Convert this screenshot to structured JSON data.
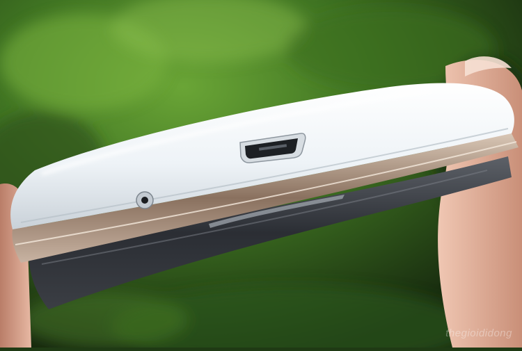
{
  "photo": {
    "subject": "phone-bottom-edge",
    "watermark_text": "thegioididong",
    "colors": {
      "foliage_dark": "#1c3512",
      "foliage_light": "#5f9a2e",
      "phone_white": "#f2f5f8",
      "chrome_trim": "#a88f7a",
      "screen_glass": "#2a2d33",
      "skin": "#e3b6a2"
    }
  }
}
